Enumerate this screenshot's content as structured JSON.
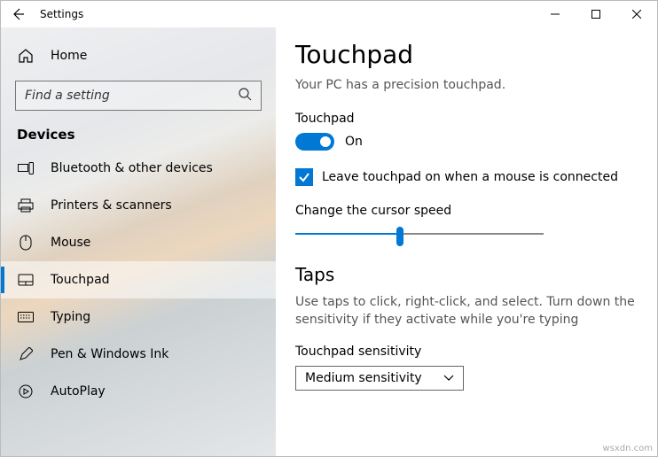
{
  "window": {
    "title": "Settings"
  },
  "sidebar": {
    "home_label": "Home",
    "search_placeholder": "Find a setting",
    "section_title": "Devices",
    "items": [
      {
        "label": "Bluetooth & other devices"
      },
      {
        "label": "Printers & scanners"
      },
      {
        "label": "Mouse"
      },
      {
        "label": "Touchpad"
      },
      {
        "label": "Typing"
      },
      {
        "label": "Pen & Windows Ink"
      },
      {
        "label": "AutoPlay"
      }
    ]
  },
  "main": {
    "page_title": "Touchpad",
    "subtitle": "Your PC has a precision touchpad.",
    "touchpad_label": "Touchpad",
    "toggle_state": "On",
    "checkbox_label": "Leave touchpad on when a mouse is connected",
    "cursor_speed_label": "Change the cursor speed",
    "taps_heading": "Taps",
    "taps_desc": "Use taps to click, right-click, and select. Turn down the sensitivity if they activate while you're typing",
    "sensitivity_label": "Touchpad sensitivity",
    "sensitivity_value": "Medium sensitivity"
  },
  "attribution": "wsxdn.com"
}
